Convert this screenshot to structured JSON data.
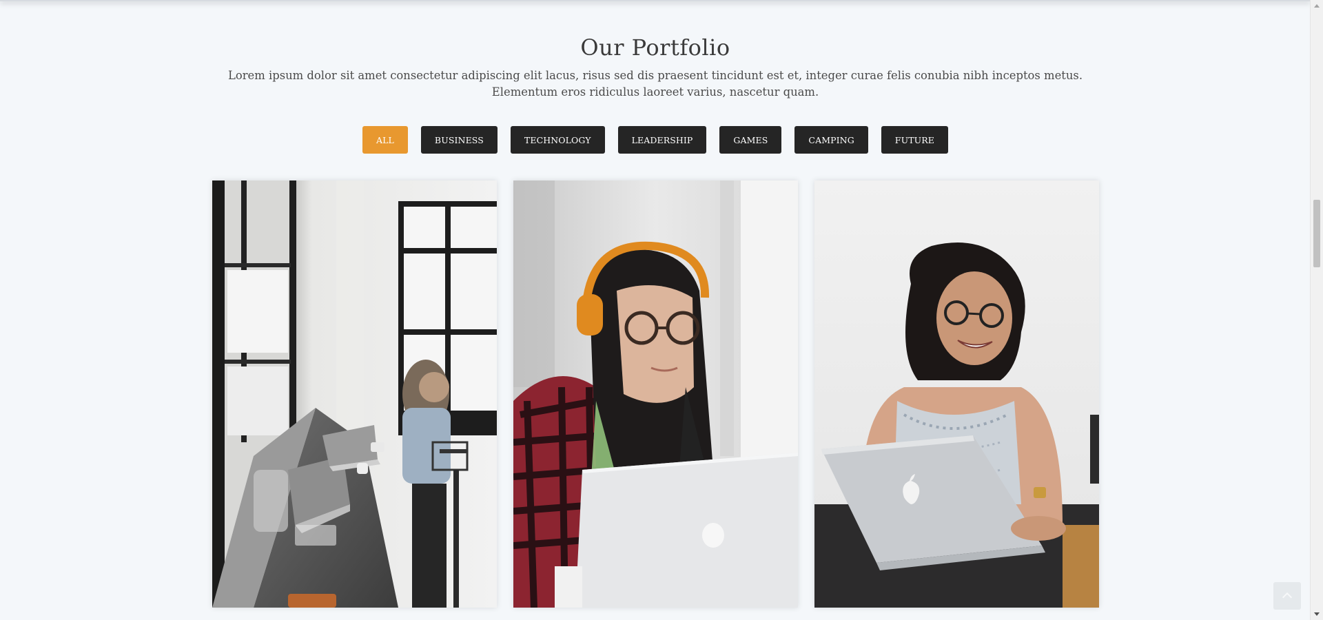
{
  "portfolio": {
    "title": "Our Portfolio",
    "description": "Lorem ipsum dolor sit amet consectetur adipiscing elit lacus, risus sed dis praesent tincidunt est et, integer curae felis conubia nibh inceptos metus. Elementum eros ridiculus laoreet varius, nascetur quam."
  },
  "filters": [
    {
      "label": "ALL",
      "active": true
    },
    {
      "label": "BUSINESS",
      "active": false
    },
    {
      "label": "TECHNOLOGY",
      "active": false
    },
    {
      "label": "LEADERSHIP",
      "active": false
    },
    {
      "label": "GAMES",
      "active": false
    },
    {
      "label": "CAMPING",
      "active": false
    },
    {
      "label": "FUTURE",
      "active": false
    }
  ],
  "colors": {
    "accent": "#e8982f",
    "button_dark": "#252525",
    "background": "#f4f7fa"
  },
  "icons": {
    "back_to_top": "chevron-up-icon"
  }
}
